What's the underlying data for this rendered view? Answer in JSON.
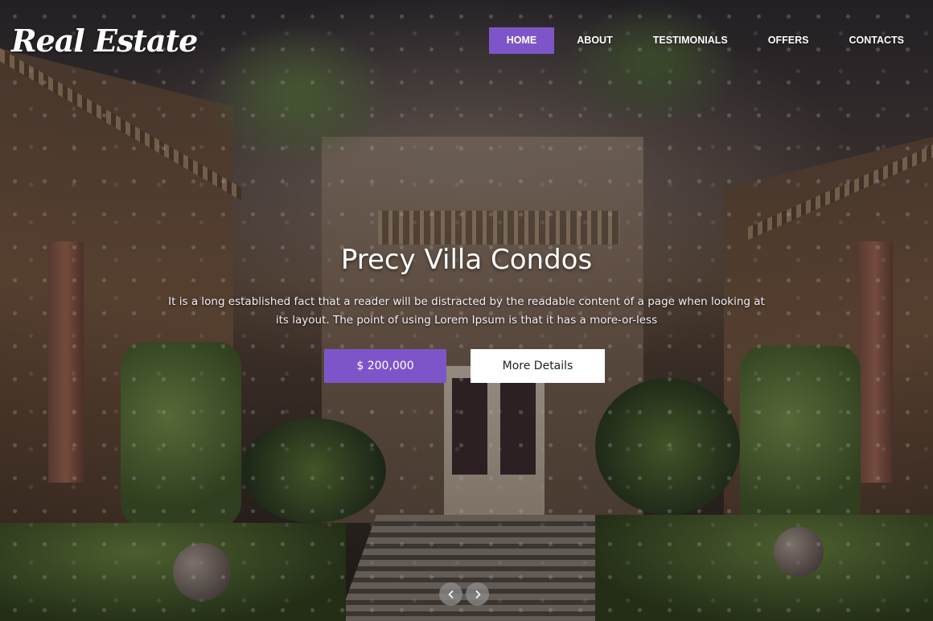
{
  "brand": {
    "logo_text": "Real Estate"
  },
  "nav": {
    "items": [
      {
        "label": "HOME",
        "active": true
      },
      {
        "label": "ABOUT",
        "active": false
      },
      {
        "label": "TESTIMONIALS",
        "active": false
      },
      {
        "label": "OFFERS",
        "active": false
      },
      {
        "label": "CONTACTS",
        "active": false
      }
    ]
  },
  "hero": {
    "title": "Precy Villa Condos",
    "description": "It is a long established fact that a reader will be distracted by the readable content of a page when looking at its layout. The point of using Lorem Ipsum is that it has a more-or-less",
    "price_button": "$ 200,000",
    "details_button": "More Details"
  },
  "slider": {
    "prev_icon": "chevron-left-icon",
    "next_icon": "chevron-right-icon"
  },
  "colors": {
    "accent": "#7e55c8",
    "button_light": "#ffffff"
  }
}
